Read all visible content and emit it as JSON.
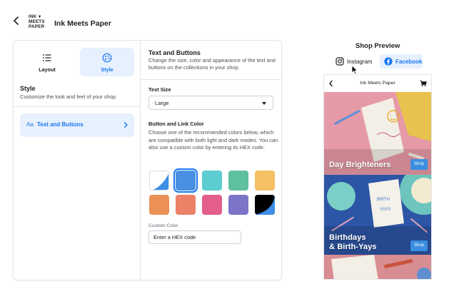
{
  "header": {
    "logo_lines": [
      "INK ♥",
      "MEETS",
      "PAPER"
    ],
    "title": "Ink Meets Paper"
  },
  "tabs": [
    {
      "label": "Layout"
    },
    {
      "label": "Style"
    }
  ],
  "style_section": {
    "title": "Style",
    "description": "Customize the look and feel of your shop.",
    "nav_item": {
      "icon_text": "Aa",
      "label": "Text and Buttons"
    }
  },
  "text_and_buttons": {
    "title": "Text and Buttons",
    "description": "Change the size, color and appearance of the text and buttons on the collections in your shop.",
    "text_size_label": "Text Size",
    "text_size_value": "Large",
    "button_link_color_label": "Button and Link Color",
    "button_link_color_desc": "Choose one of the recommended colors below, which are compatible with both light and dark modes. You can also use a custom color by entering its HEX code.",
    "swatches": [
      "#ffffff/#3d8ee6",
      "#4a90e2",
      "#5ccdd0",
      "#5fbfa1",
      "#f4c064",
      "#eb9157",
      "#ec8168",
      "#e35e8c",
      "#7c74c8",
      "#000000/#3d8ee6"
    ],
    "selected_swatch": 1,
    "custom_color_label": "Custom Color",
    "custom_color_placeholder": "Enter a HEX code"
  },
  "preview": {
    "title": "Shop Preview",
    "platforms": [
      {
        "label": "Instagram"
      },
      {
        "label": "Facebook"
      }
    ],
    "active_platform": "Facebook",
    "shop_title": "Ink Meets Paper",
    "collections": [
      {
        "name": "Day Brighteners",
        "shop_label": "Shop"
      },
      {
        "name": "Birthdays\n& Birth-Yays",
        "name_line1": "Birthdays",
        "name_line2": "& Birth-Yays",
        "shop_label": "Shop"
      }
    ]
  },
  "colors": {
    "accent": "#1877f2",
    "accent_bg": "#e7f0fd",
    "border": "#e3e5e8"
  }
}
